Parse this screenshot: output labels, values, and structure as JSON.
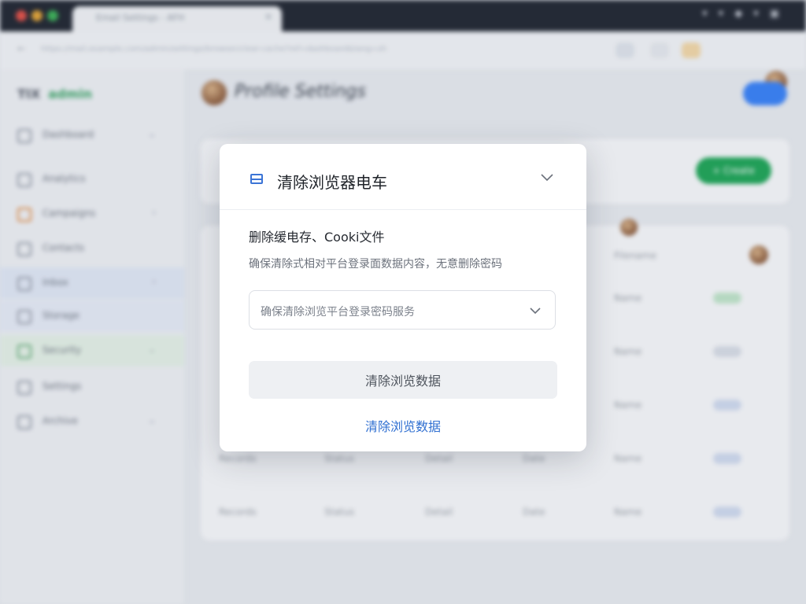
{
  "browser": {
    "tab_label": "Email Settings - AFH",
    "tab_close": "×",
    "url": "https://mail.example.com/admin/settings/browser/clear-cache?ref=dashboard&lang=zh"
  },
  "sidebar": {
    "brand": "TIX",
    "brand_accent": "admin",
    "items": [
      {
        "label": "Dashboard",
        "icon": "grid-icon"
      },
      {
        "label": "Analytics",
        "icon": "chart-icon"
      },
      {
        "label": "Campaigns",
        "icon": "megaphone-icon"
      },
      {
        "label": "Contacts",
        "icon": "contacts-icon"
      },
      {
        "label": "Inbox",
        "icon": "inbox-icon"
      },
      {
        "label": "Storage",
        "icon": "storage-icon"
      },
      {
        "label": "Security",
        "icon": "shield-icon"
      },
      {
        "label": "Settings",
        "icon": "gear-icon"
      },
      {
        "label": "Archive",
        "icon": "archive-icon"
      }
    ]
  },
  "content": {
    "title": "Profile Settings",
    "green_button": "+ Create",
    "rows": [
      {
        "col1": "Records",
        "col2": "Status",
        "col3": "Detail",
        "col4": "Date"
      },
      {
        "col1": "Records",
        "col2": "Status",
        "col3": "Detail",
        "col4": "Date"
      }
    ],
    "right_labels": [
      "Filename",
      "Name",
      "Name",
      "Name",
      "Name",
      "Name"
    ]
  },
  "modal": {
    "title": "清除浏览器电车",
    "subtitle": "删除缓电存、Cooki文件",
    "description": "确保清除式相对平台登录面数据内容，无意删除密码",
    "select_value": "确保清除浏览平台登录密码服务",
    "primary_button": "清除浏览数据",
    "link_button": "清除浏览数据"
  },
  "colors": {
    "accent_blue": "#2f6fd1",
    "primary_bg": "#eef0f3",
    "green": "#22a55a"
  }
}
